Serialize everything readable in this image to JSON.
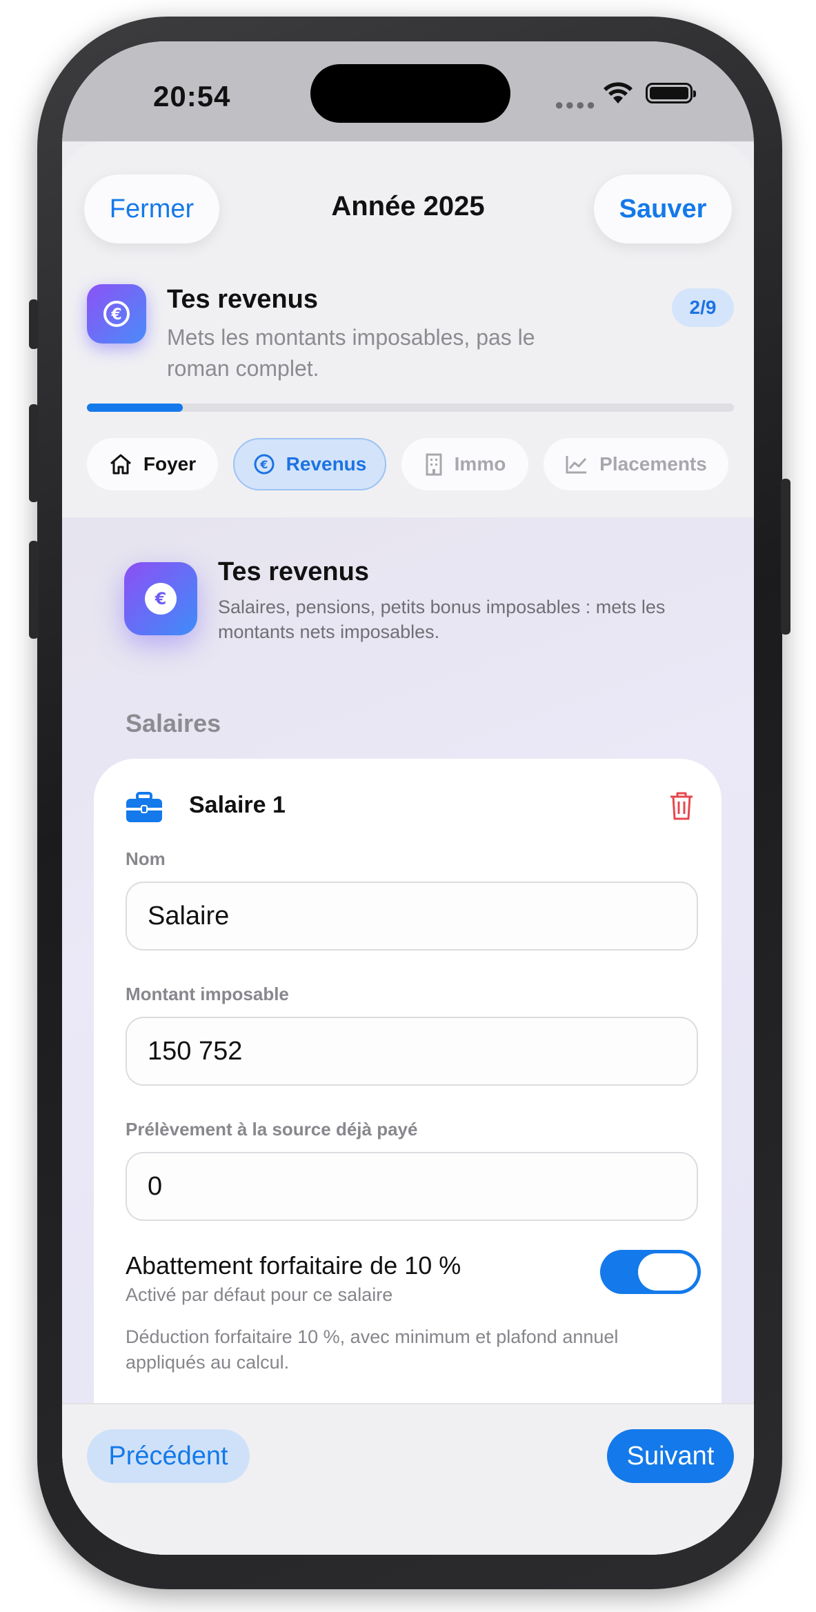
{
  "status_bar": {
    "time": "20:54"
  },
  "header": {
    "close_label": "Fermer",
    "title": "Année 2025",
    "save_label": "Sauver"
  },
  "step": {
    "title": "Tes revenus",
    "subtitle": "Mets les montants imposables, pas le roman complet.",
    "badge": "2/9",
    "progress_fraction": 0.148
  },
  "tabs": [
    {
      "label": "Foyer",
      "icon": "house-icon",
      "state": "done"
    },
    {
      "label": "Revenus",
      "icon": "euro-circle-icon",
      "state": "active"
    },
    {
      "label": "Immo",
      "icon": "building-icon",
      "state": "pending"
    },
    {
      "label": "Placements",
      "icon": "chart-line-icon",
      "state": "pending"
    }
  ],
  "hero": {
    "title": "Tes revenus",
    "subtitle": "Salaires, pensions, petits bonus imposables : mets les montants nets imposables."
  },
  "section": {
    "title": "Salaires"
  },
  "salary_card": {
    "title": "Salaire 1",
    "name_label": "Nom",
    "name_value": "Salaire",
    "amount_label": "Montant imposable",
    "amount_value": "150 752",
    "withholding_label": "Prélèvement à la source déjà payé",
    "withholding_value": "0",
    "abatement_title": "Abattement forfaitaire de 10 %",
    "abatement_subtitle": "Activé par défaut pour ce salaire",
    "abatement_enabled": true,
    "abatement_note": "Déduction forfaitaire 10 %, avec minimum et plafond annuel appliqués au calcul."
  },
  "footer": {
    "prev_label": "Précédent",
    "next_label": "Suivant"
  },
  "colors": {
    "accent": "#1479ea",
    "accent_soft": "#d3e3fa",
    "danger": "#e5484d",
    "gradient_start": "#8c52f5",
    "gradient_end": "#4a8cf9"
  }
}
